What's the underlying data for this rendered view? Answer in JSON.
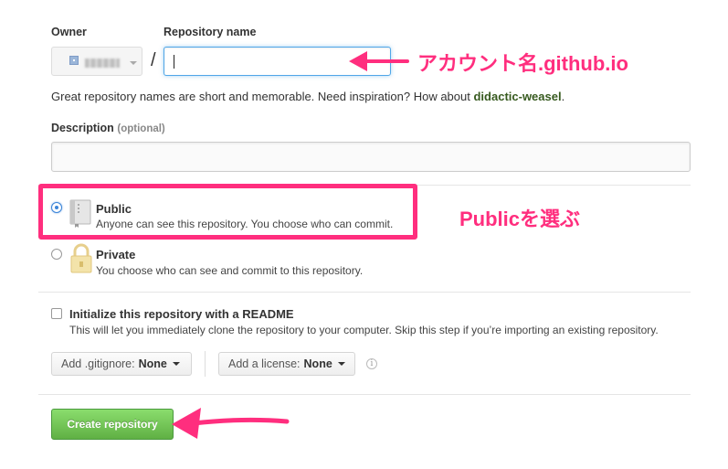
{
  "form": {
    "owner_label": "Owner",
    "repo_name_label": "Repository name",
    "slash": "/",
    "repo_name_value": "",
    "hint_text": "Great repository names are short and memorable. Need inspiration? How about",
    "hint_suggestion": "didactic-weasel",
    "hint_end": ".",
    "description_label": "Description",
    "description_optional": "(optional)",
    "description_value": ""
  },
  "visibility": {
    "public_title": "Public",
    "public_desc": "Anyone can see this repository. You choose who can commit.",
    "private_title": "Private",
    "private_desc": "You choose who can see and commit to this repository.",
    "selected": "public"
  },
  "init": {
    "readme_label": "Initialize this repository with a README",
    "readme_desc": "This will let you immediately clone the repository to your computer. Skip this step if you’re importing an existing repository.",
    "gitignore_label": "Add .gitignore:",
    "gitignore_value": "None",
    "license_label": "Add a license:",
    "license_value": "None"
  },
  "create_button": "Create repository",
  "annotations": {
    "repo_name_note": "アカウント名.github.io",
    "public_note": "Publicを選ぶ",
    "accent_color": "#ff2e7e"
  },
  "icons": {
    "public": "repo-book-icon",
    "private": "lock-icon",
    "info": "info-icon"
  }
}
